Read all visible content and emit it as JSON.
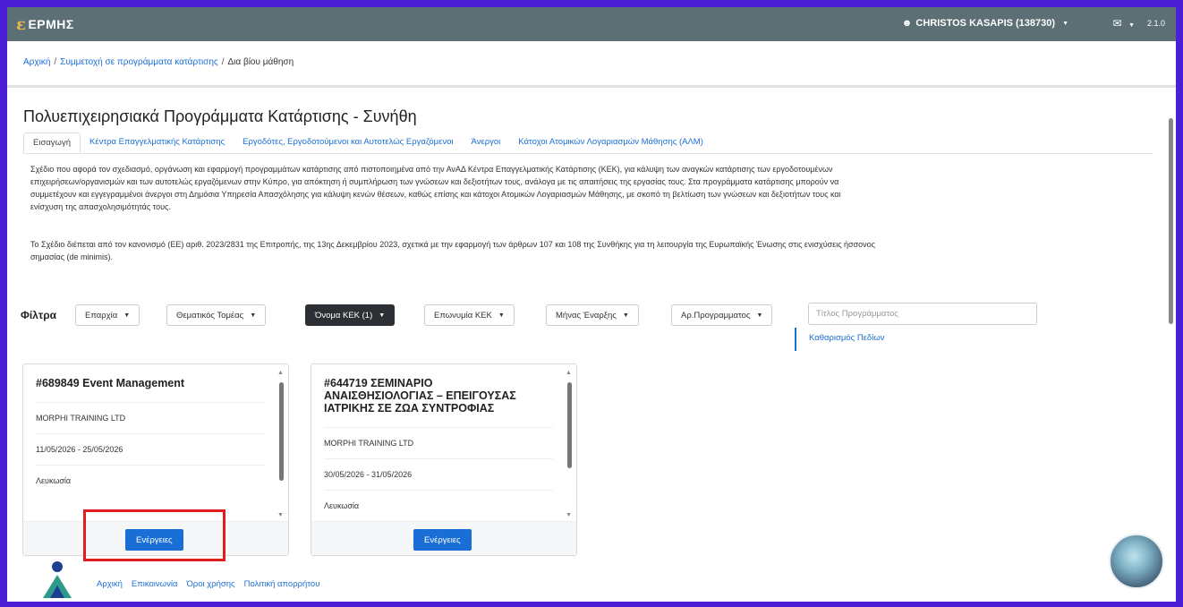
{
  "app": {
    "logo_text": "ΕΡΜΗΣ",
    "user": "CHRISTOS KASAPIS (138730)",
    "version": "2.1.0",
    "colors": {
      "topbar": "#5b6f74",
      "link": "#1a6fd6",
      "button": "#1a6fd6",
      "highlight": "#e01e1e"
    }
  },
  "breadcrumb": {
    "home": "Αρχική",
    "participation": "Συμμετοχή σε προγράμματα κατάρτισης",
    "current": "Δια βίου μάθηση"
  },
  "page": {
    "title": "Πολυεπιχειρησιακά Προγράμματα Κατάρτισης - Συνήθη",
    "tabs": [
      "Εισαγωγή",
      "Κέντρα Επαγγελματικής Κατάρτισης",
      "Εργοδότες, Εργοδοτούμενοι και Αυτοτελώς Εργαζόμενοι",
      "Άνεργοι",
      "Κάτοχοι Ατομικών Λογαριασμών Μάθησης (ΑΛΜ)"
    ],
    "paragraph1": [
      "Σχέδιο που αφορά τον σχεδιασμό, οργάνωση και εφαρμογή προγραμμάτων κατάρτισης από πιστοποιημένα από την ΑνΑΔ Κέντρα Επαγγελματικής Κατάρτισης (ΚΕΚ), για κάλυψη των αναγκών κατάρτισης των εργοδοτουμένων",
      "επιχειρήσεων/οργανισμών και των αυτοτελώς εργαζόμενων στην Κύπρο, για απόκτηση ή συμπλήρωση των γνώσεων και δεξιοτήτων τους, ανάλογα με τις απαιτήσεις της εργασίας τους. Στα προγράμματα κατάρτισης μπορούν να",
      "συμμετέχουν και εγγεγραμμένοι άνεργοι στη Δημόσια Υπηρεσία Απασχόλησης για κάλυψη κενών θέσεων, καθώς επίσης και κάτοχοι Ατομικών Λογαριασμών Μάθησης, με σκοπό τη βελτίωση των γνώσεων και δεξιοτήτων τους και",
      "ενίσχυση της απασχολησιμότητάς τους."
    ],
    "paragraph2": [
      "Το Σχέδιο διέπεται από τον κανονισμό (ΕΕ) αριθ. 2023/2831 της Επιτροπής, της 13ης Δεκεμβρίου 2023, σχετικά με την εφαρμογή των άρθρων 107 και 108 της Συνθήκης για τη λειτουργία της Ευρωπαϊκής Ένωσης στις ενισχύσεις ήσσονος",
      "σημασίας (de minimis)."
    ]
  },
  "filters": {
    "label": "Φίλτρα",
    "region": "Επαρχία",
    "sector": "Θεματικός Τομέας",
    "kek_name": "Όνομα ΚΕΚ (1)",
    "kek_brand": "Επωνυμία ΚΕΚ",
    "start_month": "Μήνας Έναρξης",
    "program_no": "Αρ.Προγραμματος",
    "title_placeholder": "Τίτλος Προγράμματος",
    "clear": "Καθαρισμός Πεδίων"
  },
  "programs": [
    {
      "title": "#689849 Event Management",
      "provider": "MORPHI TRAINING LTD",
      "dates": "11/05/2026 - 25/05/2026",
      "location": "Λευκωσία",
      "action": "Ενέργειες"
    },
    {
      "title_lines": [
        "#644719 ΣΕΜΙΝΑΡΙΟ",
        "ΑΝΑΙΣΘΗΣΙΟΛΟΓΙΑΣ – ΕΠΕΙΓΟΥΣΑΣ",
        "ΙΑΤΡΙΚΗΣ ΣΕ ΖΩΑ ΣΥΝΤΡΟΦΙΑΣ"
      ],
      "provider": "MORPHI TRAINING LTD",
      "dates": "30/05/2026 - 31/05/2026",
      "location": "Λευκωσία",
      "action": "Ενέργειες"
    }
  ],
  "footer": {
    "links": [
      "Αρχική",
      "Επικοινωνία",
      "Όροι χρήσης",
      "Πολιτική απορρήτου"
    ]
  }
}
